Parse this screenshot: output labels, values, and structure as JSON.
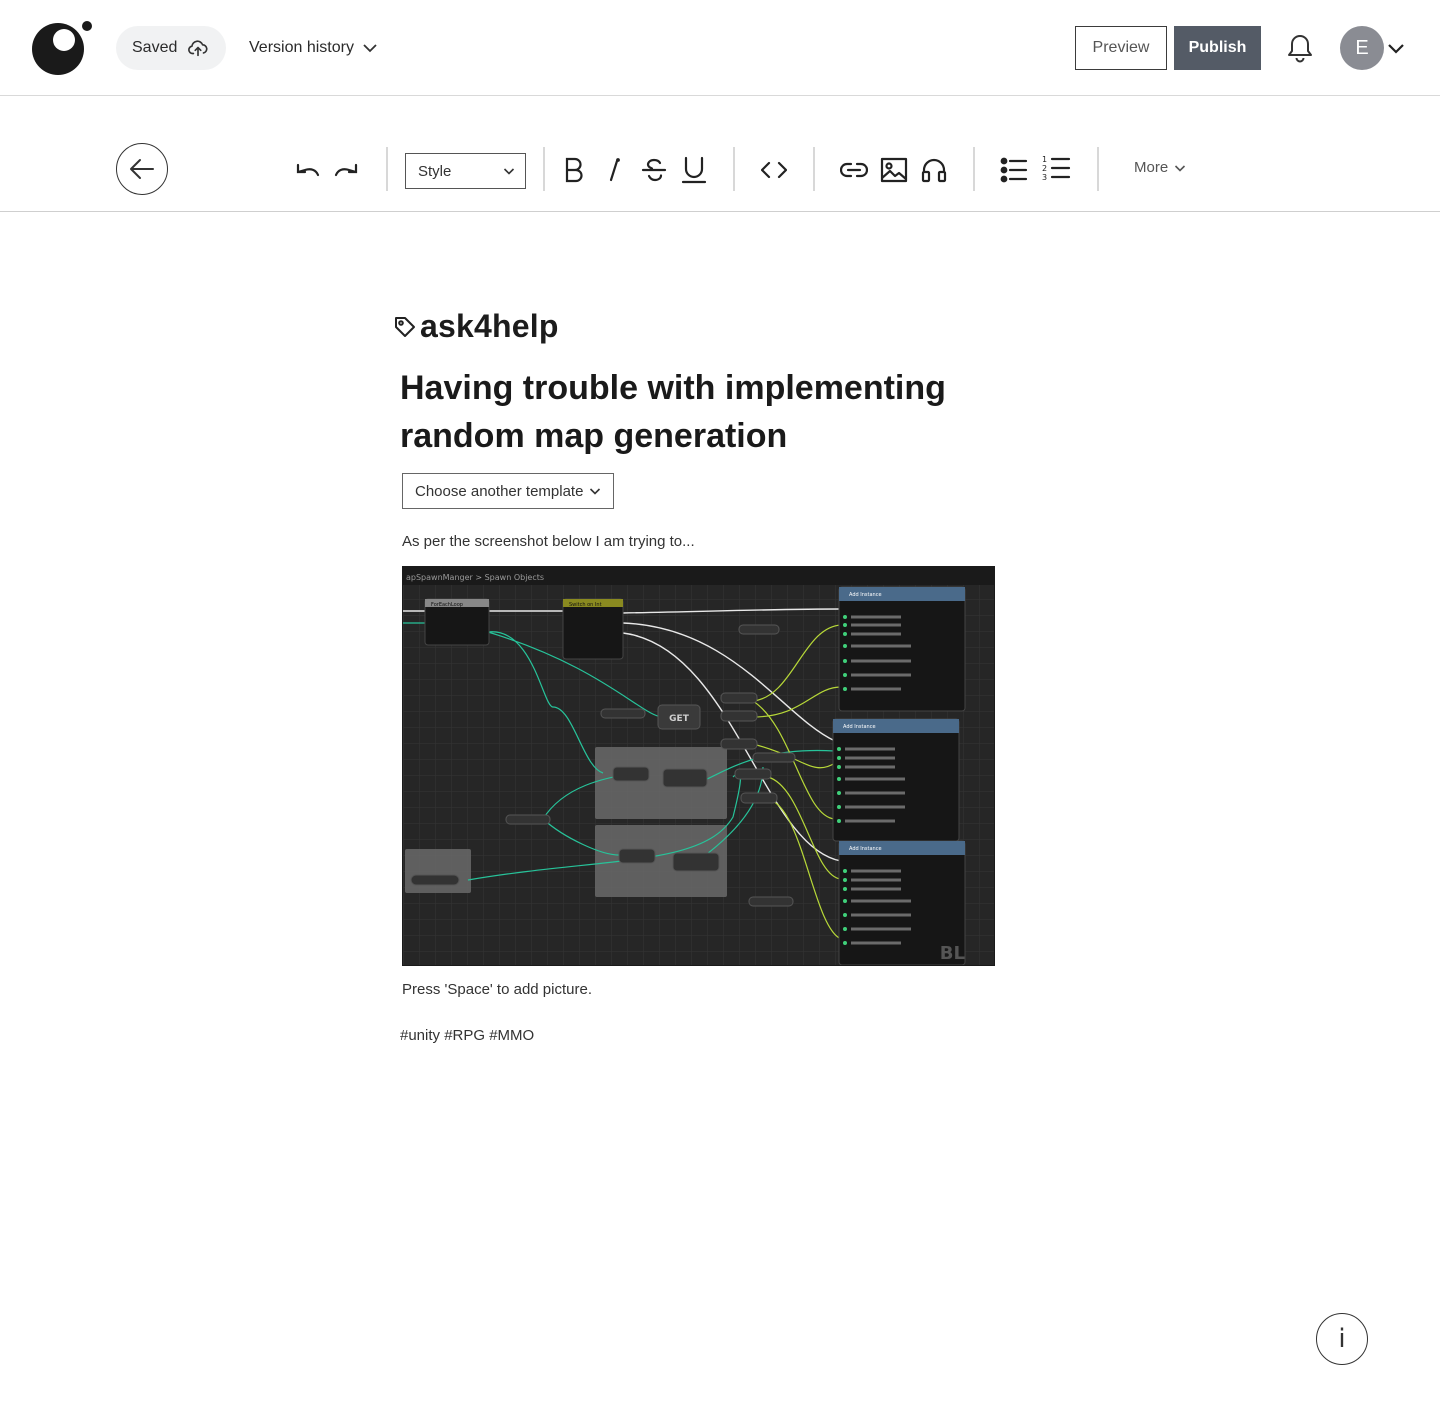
{
  "header": {
    "saved_label": "Saved",
    "version_history_label": "Version history",
    "preview_label": "Preview",
    "publish_label": "Publish",
    "avatar_initial": "E"
  },
  "toolbar": {
    "style_select_value": "Style",
    "more_label": "More",
    "icons": [
      "undo-icon",
      "redo-icon",
      "bold-icon",
      "italic-icon",
      "strikethrough-icon",
      "underline-icon",
      "code-icon",
      "link-icon",
      "image-icon",
      "audio-icon",
      "bullet-list-icon",
      "numbered-list-icon"
    ]
  },
  "post": {
    "tag": "ask4help",
    "title": "Having trouble with implementing random map generation",
    "template_select_value": "Choose another template",
    "intro_text": "As per the screenshot below I am trying to...",
    "image_caption_hint": "Press 'Space' to add picture.",
    "hashtags": "#unity #RPG #MMO",
    "image": {
      "breadcrumb": "apSpawnManger > Spawn Objects",
      "node_titles": [
        "ForEachLoop",
        "Switch on Int",
        "Add Instance",
        "Add Instance",
        "Add Instance"
      ],
      "get_label": "GET",
      "watermark": "BL"
    }
  },
  "colors": {
    "publish_bg": "#545b66",
    "avatar_bg": "#8a8c93",
    "pill_bg": "#f1f2f3",
    "image_bg": "#2b2b2b",
    "wire_green": "#27c39a",
    "wire_white": "#e8e8e8",
    "wire_yellow": "#b7d838"
  }
}
